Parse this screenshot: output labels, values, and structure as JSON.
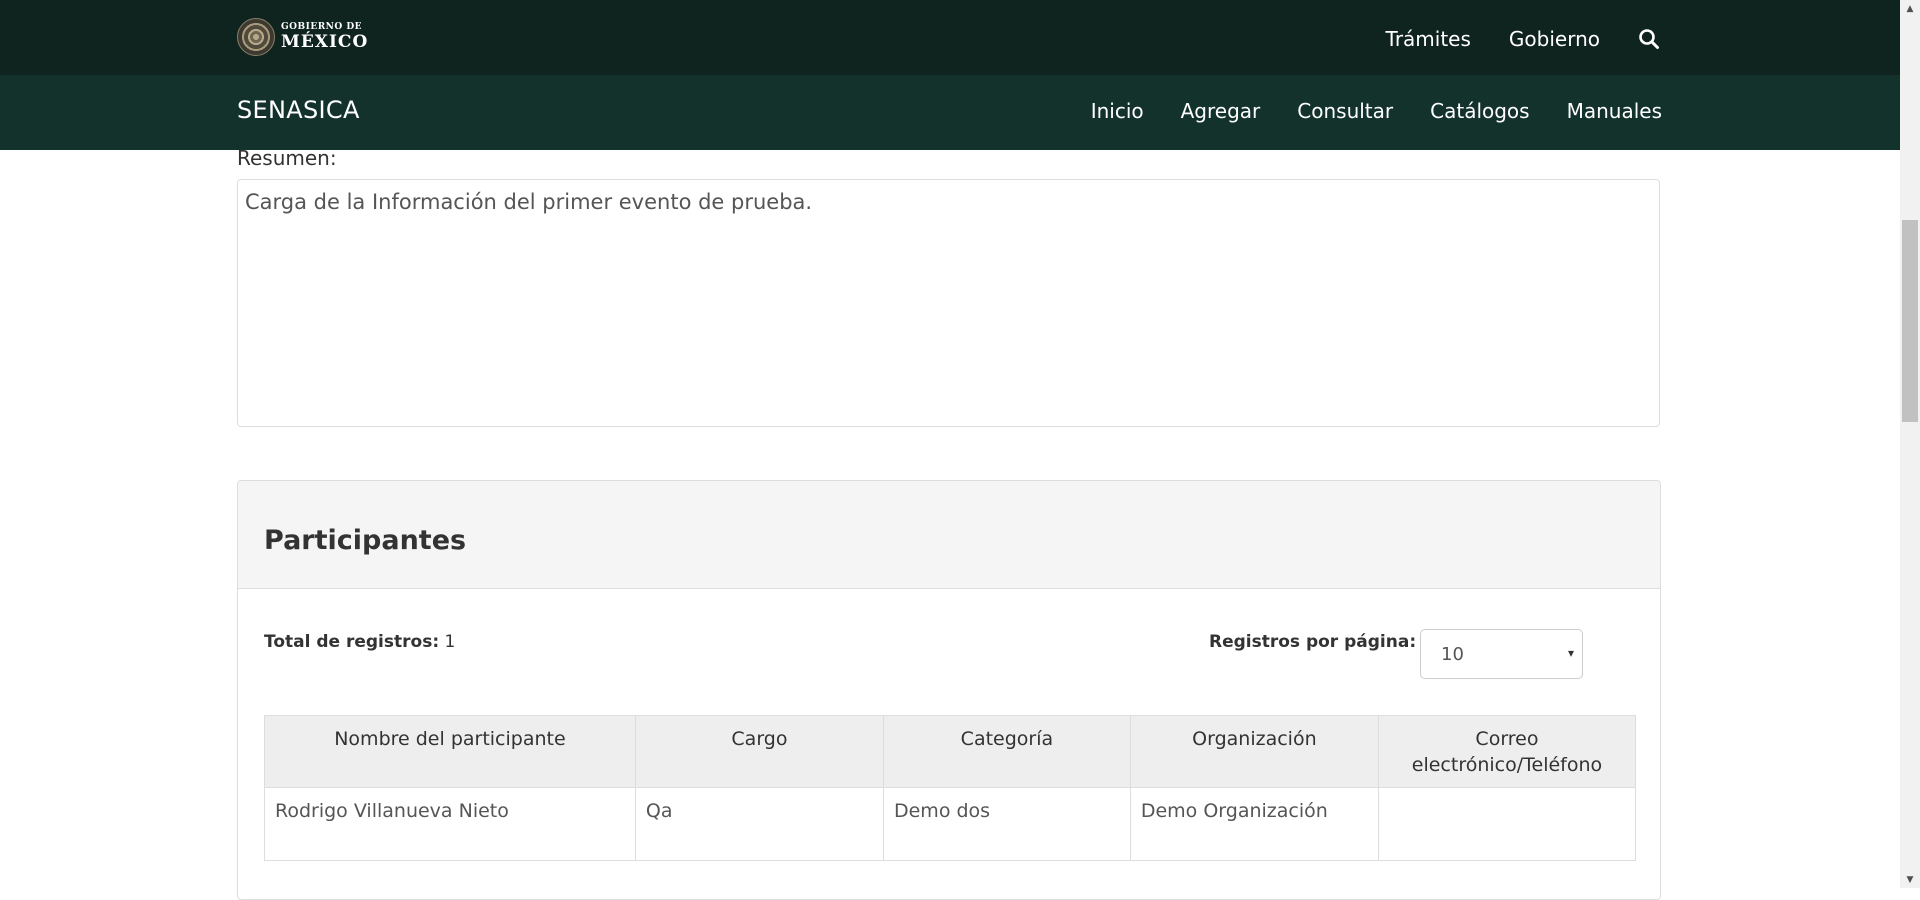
{
  "header": {
    "logo_small": "GOBIERNO DE",
    "logo_big": "MÉXICO",
    "links": [
      "Trámites",
      "Gobierno"
    ],
    "search_icon": "search-icon"
  },
  "nav": {
    "brand": "SENASICA",
    "items": [
      "Inicio",
      "Agregar",
      "Consultar",
      "Catálogos",
      "Manuales"
    ]
  },
  "resumen": {
    "label": "Resumen:",
    "value": "Carga de la Información del primer evento de prueba."
  },
  "participantes": {
    "title": "Participantes",
    "total_label": "Total de registros:",
    "total_value": "1",
    "per_page_label": "Registros por página:",
    "per_page_value": "10",
    "columns": [
      "Nombre del participante",
      "Cargo",
      "Categoría",
      "Organización",
      "Correo electrónico/Teléfono"
    ],
    "rows": [
      [
        "Rodrigo Villanueva Nieto",
        "Qa",
        "Demo dos",
        "Demo Organización",
        ""
      ]
    ]
  }
}
